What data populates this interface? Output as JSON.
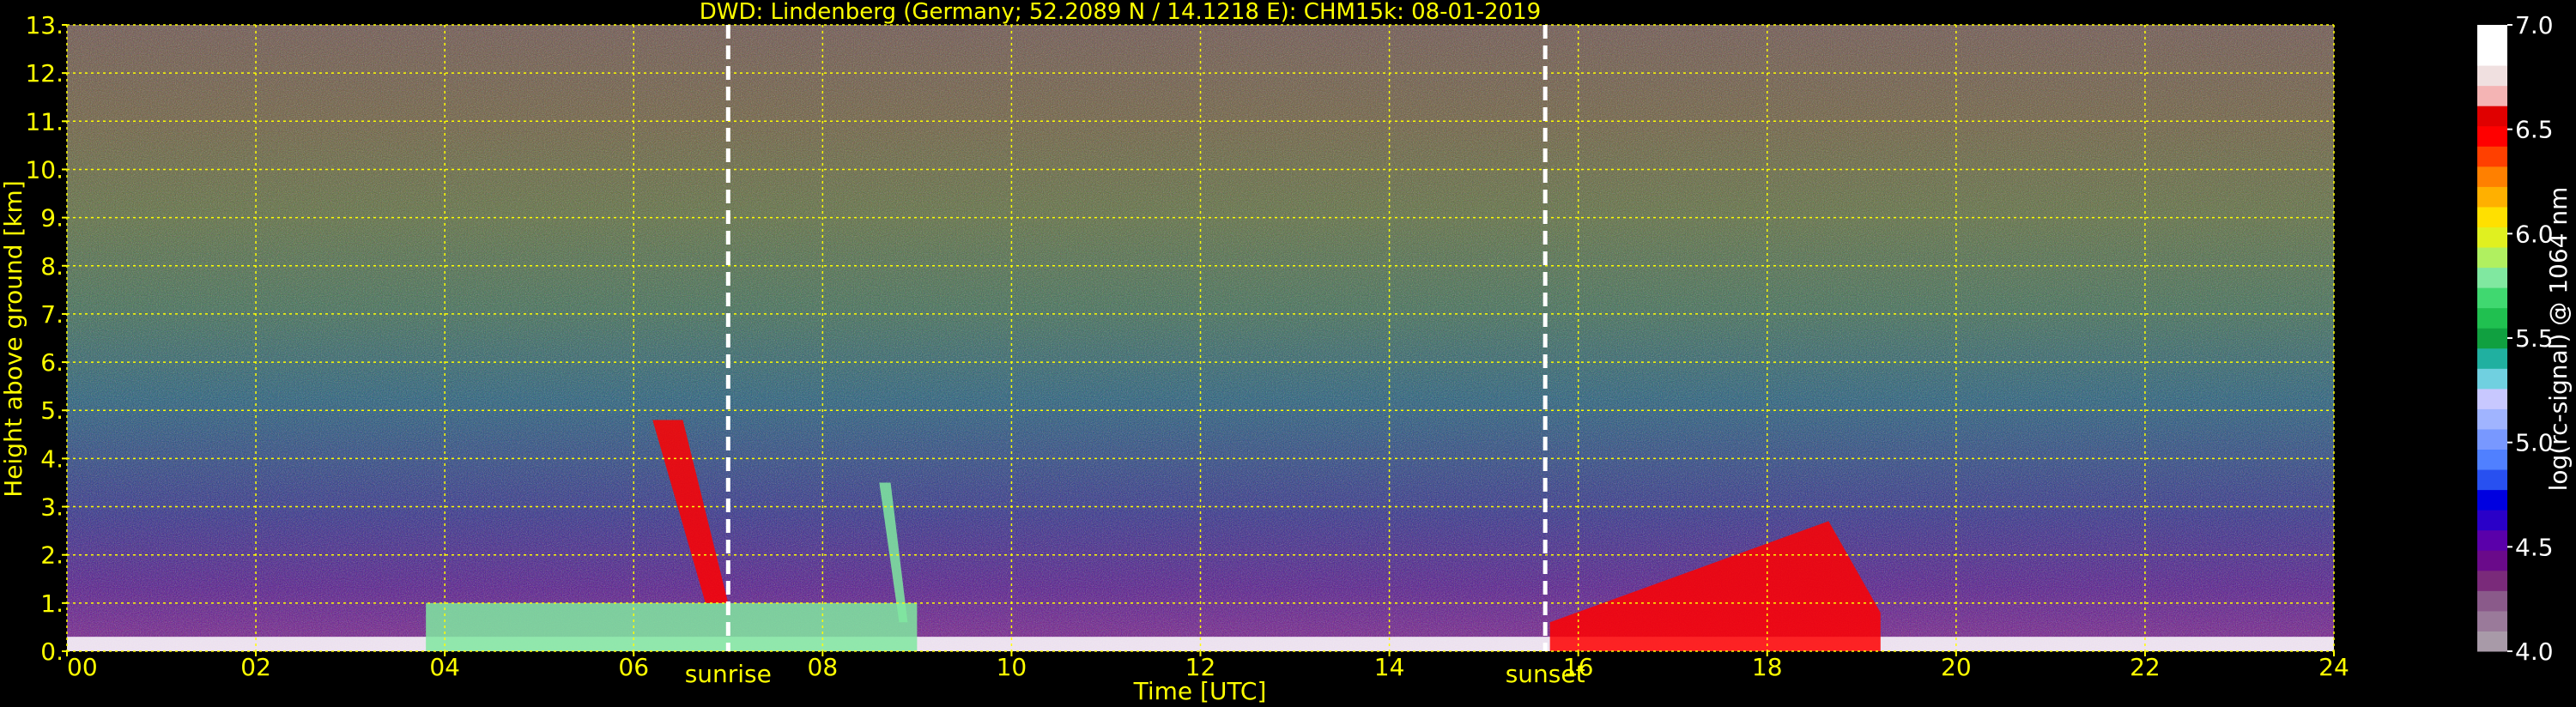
{
  "chart_data": {
    "type": "heatmap",
    "title": "DWD: Lindenberg (Germany; 52.2089 N / 14.1218 E):    CHM15k: 08-01-2019",
    "xlabel": "Time [UTC]",
    "ylabel": "Height above ground [km]",
    "xlim": [
      0,
      24
    ],
    "ylim": [
      0,
      13
    ],
    "x_ticks": [
      0,
      2,
      4,
      6,
      8,
      10,
      12,
      14,
      16,
      18,
      20,
      22,
      24
    ],
    "x_tick_labels": [
      "00",
      "02",
      "04",
      "06",
      "08",
      "10",
      "12",
      "14",
      "16",
      "18",
      "20",
      "22",
      "24"
    ],
    "y_ticks": [
      0,
      1,
      2,
      3,
      4,
      5,
      6,
      7,
      8,
      9,
      10,
      11,
      12,
      13
    ],
    "y_tick_labels": [
      "0.",
      "1.",
      "2.",
      "3.",
      "4.",
      "5.",
      "6.",
      "7.",
      "8.",
      "9.",
      "10.",
      "11.",
      "12.",
      "13."
    ],
    "grid": true,
    "events": [
      {
        "label": "sunrise",
        "time": 7.0
      },
      {
        "label": "sunset",
        "time": 15.65
      }
    ],
    "colorbar": {
      "label": "log(rc-signal) @ 1064 nm",
      "range": [
        4.0,
        7.0
      ],
      "ticks": [
        4.0,
        4.5,
        5.0,
        5.5,
        6.0,
        6.5,
        7.0
      ],
      "tick_labels": [
        "4.0",
        "4.5",
        "5.0",
        "5.5",
        "6.0",
        "6.5",
        "7.0"
      ],
      "colors": [
        "#a89aa8",
        "#9a7a9a",
        "#8a5a8a",
        "#7a2a7a",
        "#6a0a8a",
        "#5a00aa",
        "#2a00c8",
        "#0000e0",
        "#2850f0",
        "#5080ff",
        "#7898ff",
        "#a0b4ff",
        "#c8c8ff",
        "#70d0e0",
        "#20b0a0",
        "#10a040",
        "#20c050",
        "#40d870",
        "#80e8a0",
        "#b0f060",
        "#e0f020",
        "#ffe000",
        "#ffb000",
        "#ff8000",
        "#ff4000",
        "#ff0000",
        "#e00000",
        "#f4b4b4",
        "#f0e0e0",
        "#ffffff",
        "#ffffff"
      ]
    },
    "features": [
      {
        "name": "surface layer",
        "t_start": 0,
        "t_end": 24,
        "h_max_km": 0.3,
        "signal": 7.0
      },
      {
        "name": "low cloud",
        "t_start": 3.8,
        "t_end": 9.0,
        "h_max_km": 1.0,
        "signal": 5.8
      },
      {
        "name": "rising cloud",
        "t_start": 6.2,
        "t_end": 7.0,
        "h_bottom_km": 1.0,
        "h_top_km": 4.8,
        "signal": 6.5
      },
      {
        "name": "cloud column",
        "t_start": 8.6,
        "t_end": 8.9,
        "h_bottom_km": 0.6,
        "h_top_km": 3.5,
        "signal": 5.8
      },
      {
        "name": "boundary layer cloud",
        "t_start": 15.7,
        "t_end": 19.2,
        "h_max_km": 2.7,
        "signal": 6.5
      }
    ]
  }
}
